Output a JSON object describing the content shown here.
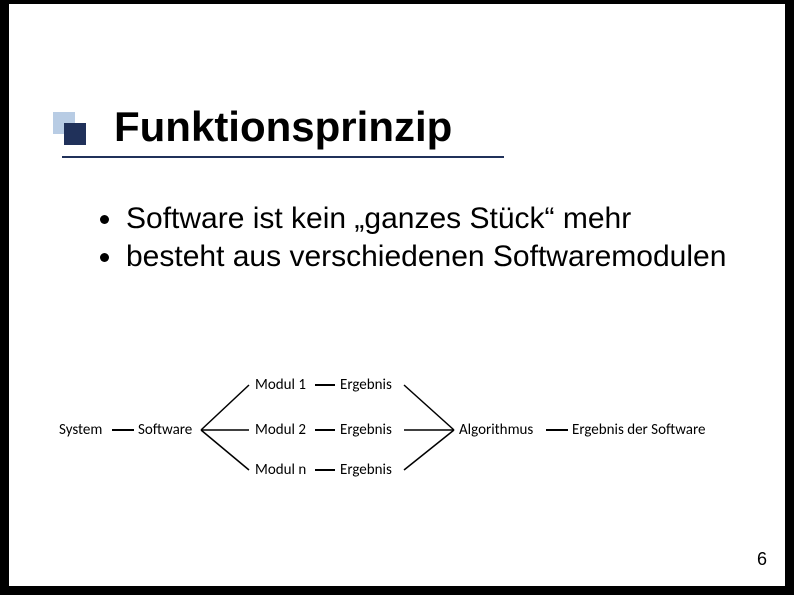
{
  "title": "Funktionsprinzip",
  "bullets": [
    "Software ist kein „ganzes Stück“ mehr",
    "besteht aus verschiedenen Softwaremodulen"
  ],
  "diagram": {
    "system": "System",
    "software": "Software",
    "modules": [
      "Modul 1",
      "Modul 2",
      "Modul n"
    ],
    "result": "Ergebnis",
    "algorithm": "Algorithmus",
    "final": "Ergebnis der Software"
  },
  "page_number": "6"
}
